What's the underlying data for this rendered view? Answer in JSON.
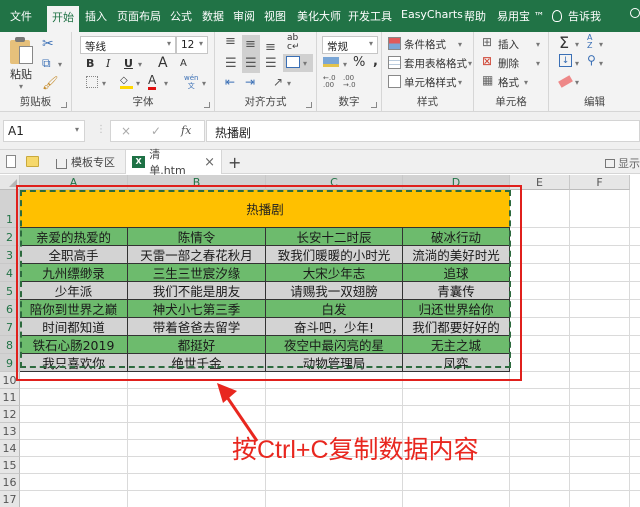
{
  "menu": {
    "tabs": [
      "文件",
      "开始",
      "插入",
      "页面布局",
      "公式",
      "数据",
      "审阅",
      "视图",
      "美化大师",
      "开发工具",
      "EasyCharts",
      "帮助",
      "易用宝 ™"
    ],
    "active_tab": "开始",
    "tell_me": "告诉我"
  },
  "ribbon": {
    "clipboard": {
      "label": "剪贴板",
      "paste": "粘贴"
    },
    "font": {
      "label": "字体",
      "font_name": "等线",
      "font_size": "12",
      "bold": "B",
      "italic": "I",
      "underline": "U",
      "grow": "A",
      "shrink": "A",
      "phonetic": "wén"
    },
    "alignment": {
      "label": "对齐方式"
    },
    "number": {
      "label": "数字",
      "format": "常规",
      "percent": "%",
      "comma": ","
    },
    "styles": {
      "label": "样式",
      "conditional": "条件格式",
      "table": "套用表格格式",
      "cell_styles": "单元格样式"
    },
    "cells": {
      "label": "单元格",
      "insert": "插入",
      "delete": "删除",
      "format": "格式"
    },
    "editing": {
      "label": "编辑"
    }
  },
  "formula_bar": {
    "name_box": "A1",
    "cancel": "×",
    "enter": "✓",
    "fx": "fx",
    "value": "热播剧"
  },
  "doc_tabs": {
    "template": "模板专区",
    "file": "清单.htm",
    "close": "×",
    "add": "+",
    "show": "显示"
  },
  "sheet": {
    "columns": [
      "A",
      "B",
      "C",
      "D",
      "E",
      "F"
    ],
    "rows": [
      "1",
      "2",
      "3",
      "4",
      "5",
      "6",
      "7",
      "8",
      "9",
      "10",
      "11",
      "12",
      "13",
      "14",
      "15",
      "16",
      "17"
    ],
    "title": "热播剧",
    "data": [
      [
        "亲爱的热爱的",
        "陈情令",
        "长安十二时辰",
        "破冰行动"
      ],
      [
        "全职高手",
        "天雷一部之春花秋月",
        "致我们暖暖的小时光",
        "流淌的美好时光"
      ],
      [
        "九州缥缈录",
        "三生三世宸汐缘",
        "大宋少年志",
        "追球"
      ],
      [
        "少年派",
        "我们不能是朋友",
        "请赐我一双翅膀",
        "青囊传"
      ],
      [
        "陪你到世界之巅",
        "神犬小七第三季",
        "白发",
        "归还世界给你"
      ],
      [
        "时间都知道",
        "带着爸爸去留学",
        "奋斗吧，少年!",
        "我们都要好好的"
      ],
      [
        "铁石心肠2019",
        "都挺好",
        "夜空中最闪亮的星",
        "无主之城"
      ],
      [
        "我只喜欢你",
        "绝世千金",
        "动物管理局",
        "凤弈"
      ]
    ],
    "row_colors": [
      "green",
      "gray",
      "green",
      "gray",
      "green",
      "gray",
      "green",
      "gray"
    ]
  },
  "colors": {
    "brand": "#217346",
    "title_fill": "#ffc000",
    "green_fill": "#6dbb6d",
    "gray_fill": "#d3d3d3",
    "annotation": "#e8271f"
  },
  "annotation": {
    "text": "按Ctrl+C复制数据内容"
  }
}
